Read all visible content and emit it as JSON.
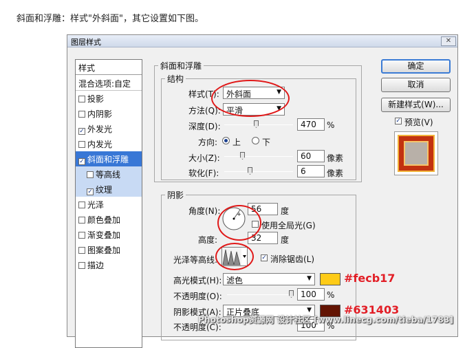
{
  "caption": "斜面和浮雕：样式\"外斜面\"，其它设置如下图。",
  "dialog": {
    "title": "图层样式",
    "close_glyph": "✕"
  },
  "style_list": {
    "header": "样式",
    "blend_options": "混合选项:自定",
    "items": [
      {
        "label": "投影",
        "checked": false
      },
      {
        "label": "内阴影",
        "checked": false
      },
      {
        "label": "外发光",
        "checked": true
      },
      {
        "label": "内发光",
        "checked": false
      },
      {
        "label": "斜面和浮雕",
        "checked": true,
        "selected": true
      },
      {
        "label": "等高线",
        "checked": false,
        "sub": true
      },
      {
        "label": "纹理",
        "checked": true,
        "sub": true
      },
      {
        "label": "光泽",
        "checked": false
      },
      {
        "label": "颜色叠加",
        "checked": false
      },
      {
        "label": "渐变叠加",
        "checked": false
      },
      {
        "label": "图案叠加",
        "checked": false
      },
      {
        "label": "描边",
        "checked": false
      }
    ]
  },
  "bevel": {
    "group_title": "斜面和浮雕",
    "structure_title": "结构",
    "style_label": "样式(T):",
    "style_value": "外斜面",
    "technique_label": "方法(Q):",
    "technique_value": "平滑",
    "depth_label": "深度(D):",
    "depth_value": "470",
    "depth_unit": "%",
    "direction_label": "方向:",
    "direction_up": "上",
    "direction_down": "下",
    "size_label": "大小(Z):",
    "size_value": "60",
    "size_unit": "像素",
    "soften_label": "软化(F):",
    "soften_value": "6",
    "soften_unit": "像素"
  },
  "shading": {
    "title": "阴影",
    "angle_label": "角度(N):",
    "angle_value": "56",
    "angle_unit": "度",
    "global_light_label": "使用全局光(G)",
    "altitude_label": "高度:",
    "altitude_value": "32",
    "altitude_unit": "度",
    "gloss_label": "光泽等高线:",
    "antialias_label": "消除锯齿(L)",
    "highlight_label": "高光模式(H):",
    "highlight_mode": "滤色",
    "highlight_color": "#fecb17",
    "highlight_hex": "#fecb17",
    "opacity1_label": "不透明度(O):",
    "opacity1_value": "100",
    "opacity1_unit": "%",
    "shadow_label": "阴影模式(A):",
    "shadow_mode": "正片叠底",
    "shadow_color": "#631403",
    "shadow_hex": "#631403",
    "opacity2_label": "不透明度(C):",
    "opacity2_value": "100",
    "opacity2_unit": "%"
  },
  "buttons": {
    "ok": "确定",
    "cancel": "取消",
    "new_style": "新建样式(W)...",
    "preview": "预览(V)"
  },
  "watermark": "Photoshop资源网 设计社区 [www.linecg.com/tieba/1783]"
}
